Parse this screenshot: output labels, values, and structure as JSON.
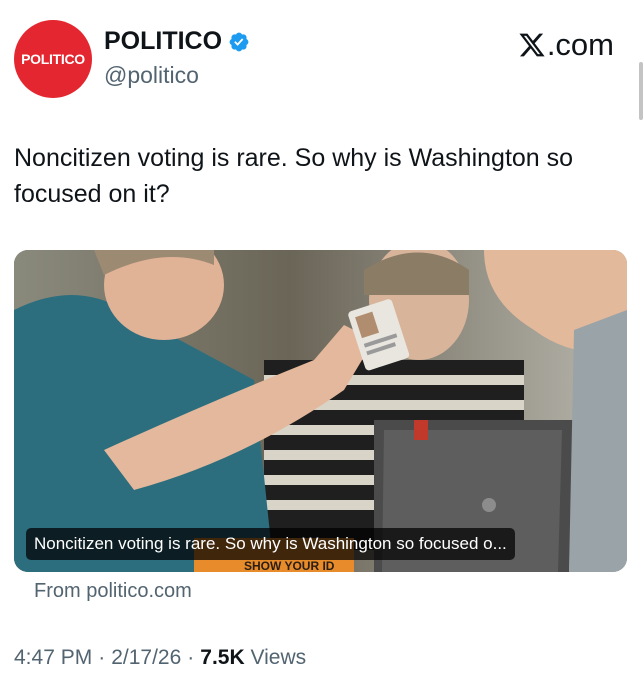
{
  "author": {
    "avatar_text": "POLITICO",
    "display_name": "POLITICO",
    "handle": "@politico"
  },
  "brand": {
    "label": ".com"
  },
  "tweet": {
    "text": "Noncitizen voting is rare. So why is Washington so focused on it?"
  },
  "card": {
    "caption": "Noncitizen voting is rare. So why is Washington so focused o...",
    "sign_text": "SHOW YOUR ID",
    "source": "From politico.com"
  },
  "meta": {
    "time": "4:47 PM",
    "separator": "·",
    "date": "2/17/26",
    "views_count": "7.5K",
    "views_label": "Views"
  },
  "colors": {
    "avatar_bg": "#e3262f",
    "verified": "#1d9bf0",
    "text_primary": "#0f1419",
    "text_secondary": "#536471"
  },
  "icons": {
    "verified": "verified-badge-icon",
    "x_logo": "x-logo-icon"
  }
}
